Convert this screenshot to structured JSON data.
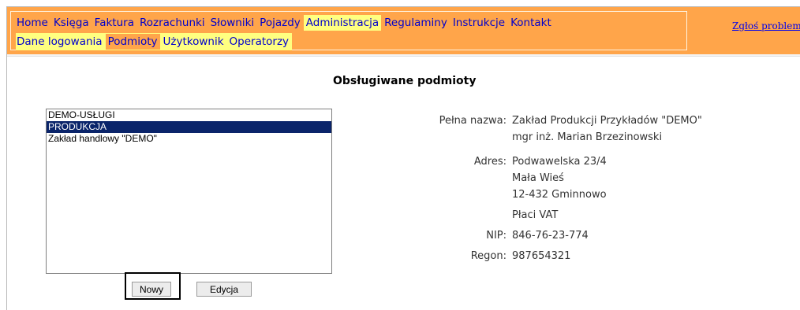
{
  "menu": {
    "primary": [
      {
        "label": "Home",
        "active": false
      },
      {
        "label": "Księga",
        "active": false
      },
      {
        "label": "Faktura",
        "active": false
      },
      {
        "label": "Rozrachunki",
        "active": false
      },
      {
        "label": "Słowniki",
        "active": false
      },
      {
        "label": "Pojazdy",
        "active": false
      },
      {
        "label": "Administracja",
        "active": true
      },
      {
        "label": "Regulaminy",
        "active": false
      },
      {
        "label": "Instrukcje",
        "active": false
      },
      {
        "label": "Kontakt",
        "active": false
      }
    ],
    "secondary": [
      {
        "label": "Dane logowania",
        "active": false
      },
      {
        "label": "Podmioty",
        "active": true
      },
      {
        "label": "Użytkownik",
        "active": false
      },
      {
        "label": "Operatorzy",
        "active": false
      }
    ],
    "report_link": "Zgłoś problem"
  },
  "page": {
    "title": "Obsługiwane podmioty"
  },
  "entities": {
    "items": [
      {
        "label": "DEMO-USŁUGI",
        "selected": false
      },
      {
        "label": "PRODUKCJA",
        "selected": true
      },
      {
        "label": "Zakład handlowy \"DEMO\"",
        "selected": false
      }
    ]
  },
  "buttons": {
    "new_label": "Nowy",
    "edit_label": "Edycja"
  },
  "details": {
    "full_name_label": "Pełna nazwa:",
    "full_name": "Zakład Produkcji Przykładów \"DEMO\"",
    "contact_person": "mgr inż. Marian Brzezinowski",
    "address_label": "Adres:",
    "address_street": "Podwawelska 23/4",
    "address_city": "Mała Wieś",
    "address_postal": "12-432 Gminnowo",
    "vat_status": "Płaci VAT",
    "nip_label": "NIP:",
    "nip": "846-76-23-774",
    "regon_label": "Regon:",
    "regon": "987654321"
  },
  "colors": {
    "bar": "#ffa54a",
    "menu_highlight": "#ffff80",
    "link": "#0000cc",
    "selection": "#0a246a"
  }
}
